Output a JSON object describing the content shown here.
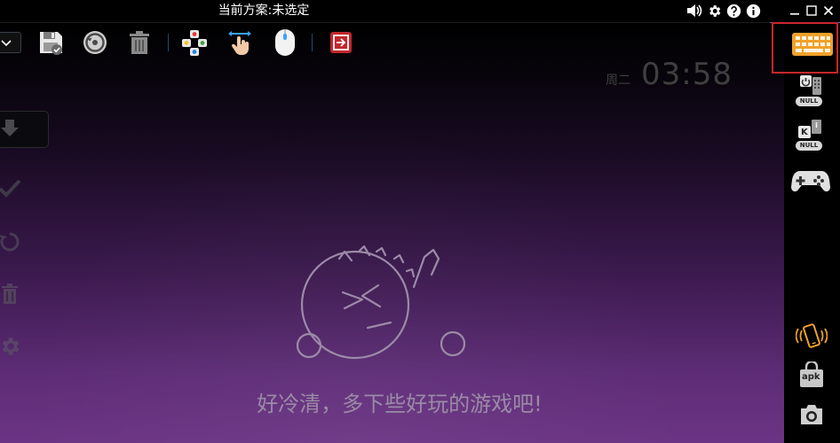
{
  "window": {
    "title": "当前方案:未选定"
  },
  "clock": {
    "day": "周二",
    "time": "03:58"
  },
  "empty_state": {
    "message": "好冷清，多下些好玩的游戏吧!"
  },
  "right_panel": {
    "null_badge_1": "NULL",
    "null_badge_2": "NULL",
    "key_label": "K",
    "apk_label": "apk"
  },
  "colors": {
    "accent_blue": "#2f7dd8",
    "selection_red": "#c8262b",
    "keyboard_orange": "#f0a12a",
    "message_text": "#9b8aa6"
  }
}
